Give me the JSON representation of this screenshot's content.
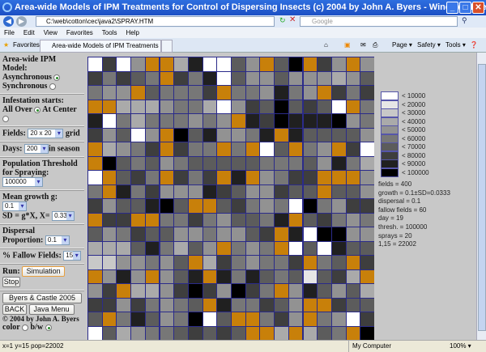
{
  "window": {
    "title": "Area-wide Models of IPM Treatments for Control of Dispersing Insects (c) 2004 by John A. Byers - Windows Internet Explorer",
    "url": "C:\\web\\cotton\\cec\\java2\\SPRAY.HTM",
    "search_placeholder": "Google",
    "minimize": "_",
    "maximize": "□",
    "close": "✕"
  },
  "menu": [
    "File",
    "Edit",
    "View",
    "Favorites",
    "Tools",
    "Help"
  ],
  "favorites": {
    "label": "Favorites",
    "tab": "Area-wide Models of IPM Treatments for Control of Di...",
    "commands": [
      "Page ▾",
      "Safety ▾",
      "Tools ▾"
    ]
  },
  "panel": {
    "model_title": "Area-wide IPM Model:",
    "async": "Asynchronous",
    "sync": "Synchronous",
    "model_selected": "Asynchronous",
    "infest_title": "Infestation starts:",
    "all_over": "All Over",
    "at_center": "At Center",
    "infest_selected": "All Over",
    "fields_label": "Fields:",
    "fields_value": "20 x 20",
    "fields_suffix": "grid",
    "days_label": "Days:",
    "days_value": "200",
    "days_suffix": "in season",
    "threshold_title": "Population Threshold",
    "threshold_label": "for Spraying:",
    "threshold_value": "100000",
    "growth_label": "Mean growth g:",
    "growth_value": "0.1",
    "sd_label": "SD = g*X, X=",
    "sd_value": "0.333",
    "dispersal_title": "Dispersal",
    "dispersal_label": "Proportion:",
    "dispersal_value": "0.1",
    "fallow_label": "% Fallow Fields:",
    "fallow_value": "15",
    "run_label": "Run:",
    "simulation": "Simulation",
    "stop": "Stop",
    "ref_button": "Byers & Castle 2005",
    "back": "BACK",
    "java_menu": "Java Menu",
    "copyright": "© 2004 by John A. Byers",
    "color": "color",
    "bw": "b/w",
    "display_selected": "b/w"
  },
  "legend": [
    {
      "label": "< 10000",
      "color": "#ffffff"
    },
    {
      "label": "< 20000",
      "color": "#e6e6e6"
    },
    {
      "label": "< 30000",
      "color": "#c8c8c8"
    },
    {
      "label": "< 40000",
      "color": "#aaaaaa"
    },
    {
      "label": "< 50000",
      "color": "#929292"
    },
    {
      "label": "< 60000",
      "color": "#777777"
    },
    {
      "label": "< 70000",
      "color": "#5c5c5c"
    },
    {
      "label": "< 80000",
      "color": "#3e3e3e"
    },
    {
      "label": "< 90000",
      "color": "#202020"
    },
    {
      "label": "< 100000",
      "color": "#000000"
    }
  ],
  "fallow_color": "#c8800a",
  "stats": [
    "fields = 400",
    "growth = 0.1±SD=0.0333",
    "dispersal = 0.1",
    "fallow fields = 60",
    "day = 19",
    "thresh. = 100000",
    "sprays = 20",
    "1,15 = 22002"
  ],
  "status": {
    "text": "x=1  y=15  pop=22002",
    "zone": "My Computer",
    "zoom": "100% ▾"
  },
  "grid_rows": [
    "0704FF380064F69F74F4",
    "75765F75806446444346",
    "544F65557F554854F757",
    "FF3334553047696760F5",
    "8053555454F879888945",
    "74604F9684458F866664",
    "F3457F755F5F06F54F70",
    "F9656456666655564853",
    "0F675F757F8F4577FFF4",
    "5F85744487644766F664",
    "7466896FF67545095477",
    "F77FF557546658F67545",
    "6457664454467F809944",
    "333685364F545F060866",
    "2244546F3754557F56F7",
    "F484F468F8586561673F",
    "47F3347974975F486463",
    "77475456F855764FF766",
    "6F58645906FF574F5407",
    "06345567676FF3F365F9"
  ]
}
